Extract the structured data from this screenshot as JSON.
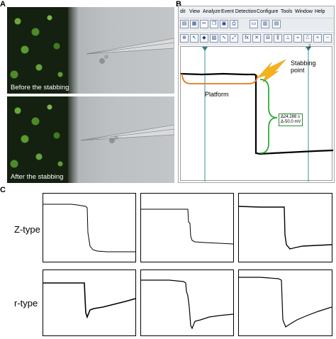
{
  "panel_letters": {
    "a": "A",
    "b": "B",
    "c": "C"
  },
  "panel_a": {
    "top_caption": "Before the stabbing",
    "bottom_caption": "After the stabbing"
  },
  "panel_b": {
    "menu": [
      "dit",
      "View",
      "Analyze",
      "Event Detection",
      "Configure",
      "Tools",
      "Window",
      "Help"
    ],
    "toolbar1_icons": [
      "open-icon",
      "save-icon",
      "cut-icon",
      "copy-icon",
      "paste-icon",
      "print-icon",
      "monitor-icon",
      "layout-icon",
      "split-icon"
    ],
    "toolbar2_icons": [
      "zoom-icon",
      "cursor-icon",
      "marker-icon",
      "scale-icon",
      "graph-icon",
      "fit-icon",
      "fx-icon",
      "xy-icon",
      "measure-icon",
      "cursor-pair-icon",
      "baseline-icon",
      "event-icon",
      "detect-icon",
      "plus-icon",
      "minus-icon"
    ],
    "cursor_label": "2",
    "platform_label": "Platform",
    "stabbing_label": "Stabbing\npoint",
    "delta_time": "Δ24.286 s",
    "delta_voltage": "Δ-50.0 mV",
    "colors": {
      "trace": "#000000",
      "cursor": "#3a8fa0",
      "bracket_orange": "#e07a1f",
      "bracket_green": "#2faa3c",
      "lightning": "#f5b21b"
    }
  },
  "panel_c": {
    "row_labels": [
      "Z-type",
      "r-type"
    ]
  }
}
